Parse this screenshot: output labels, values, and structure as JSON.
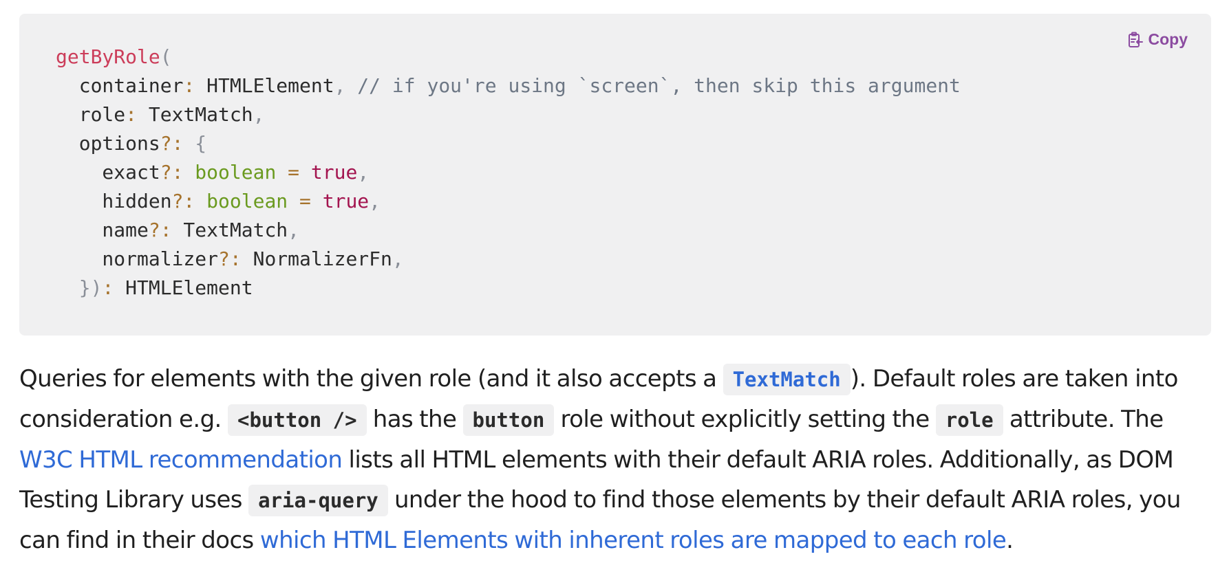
{
  "code_block": {
    "copy_label": "Copy",
    "copy_icon": "clipboard-copy-icon",
    "lines": [
      [
        {
          "t": "getByRole",
          "c": "fn"
        },
        {
          "t": "(",
          "c": "punct"
        }
      ],
      [
        {
          "t": "  container",
          "c": "plain"
        },
        {
          "t": ":",
          "c": "op"
        },
        {
          "t": " HTMLElement",
          "c": "plain"
        },
        {
          "t": ",",
          "c": "punct"
        },
        {
          "t": " // if you're using `screen`, then skip this argument",
          "c": "comment"
        }
      ],
      [
        {
          "t": "  role",
          "c": "plain"
        },
        {
          "t": ":",
          "c": "op"
        },
        {
          "t": " TextMatch",
          "c": "plain"
        },
        {
          "t": ",",
          "c": "punct"
        }
      ],
      [
        {
          "t": "  options",
          "c": "plain"
        },
        {
          "t": "?:",
          "c": "op"
        },
        {
          "t": " {",
          "c": "punct"
        }
      ],
      [
        {
          "t": "    exact",
          "c": "plain"
        },
        {
          "t": "?:",
          "c": "op"
        },
        {
          "t": " boolean",
          "c": "type"
        },
        {
          "t": " =",
          "c": "op"
        },
        {
          "t": " true",
          "c": "kw"
        },
        {
          "t": ",",
          "c": "punct"
        }
      ],
      [
        {
          "t": "    hidden",
          "c": "plain"
        },
        {
          "t": "?:",
          "c": "op"
        },
        {
          "t": " boolean",
          "c": "type"
        },
        {
          "t": " =",
          "c": "op"
        },
        {
          "t": " true",
          "c": "kw"
        },
        {
          "t": ",",
          "c": "punct"
        }
      ],
      [
        {
          "t": "    name",
          "c": "plain"
        },
        {
          "t": "?:",
          "c": "op"
        },
        {
          "t": " TextMatch",
          "c": "plain"
        },
        {
          "t": ",",
          "c": "punct"
        }
      ],
      [
        {
          "t": "    normalizer",
          "c": "plain"
        },
        {
          "t": "?:",
          "c": "op"
        },
        {
          "t": " NormalizerFn",
          "c": "plain"
        },
        {
          "t": ",",
          "c": "punct"
        }
      ],
      [
        {
          "t": "  })",
          "c": "punct"
        },
        {
          "t": ":",
          "c": "op"
        },
        {
          "t": " HTMLElement",
          "c": "plain"
        }
      ]
    ]
  },
  "description": {
    "p1": "Queries for elements with the given role (and it also accepts a ",
    "code_textmatch": "TextMatch",
    "p2": "). Default roles are taken into consideration e.g. ",
    "code_button_tag": "<button />",
    "p3": " has the ",
    "code_button": "button",
    "p4": " role without explicitly setting the ",
    "code_role": "role",
    "p5": " attribute. The ",
    "link_w3c": "W3C HTML recommendation",
    "p6": " lists all HTML elements with their default ARIA roles. Additionally, as DOM Testing Library uses ",
    "code_aria_query": "aria-query",
    "p7": " under the hood to find those elements by their default ARIA roles, you can find in their docs ",
    "link_mapped": "which HTML Elements with inherent roles are mapped to each role",
    "p8": "."
  },
  "colors": {
    "link": "#2f6ad6",
    "copy_accent": "#8b4ba0",
    "code_bg": "#f0f0f1"
  }
}
